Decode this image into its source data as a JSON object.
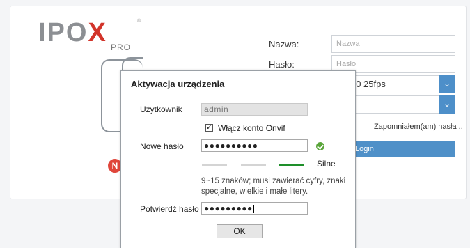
{
  "brand": {
    "logo_main": "IPO",
    "logo_x": "X",
    "logo_sub": "PRO",
    "logo_reg": "®",
    "accent": "#4f90c8",
    "logo_red": "#d2342a"
  },
  "login": {
    "username_label": "Nazwa:",
    "username_placeholder": "Nazwa",
    "password_label": "Hasło:",
    "password_placeholder": "Hasło",
    "stream_select_value": "x1080 25fps",
    "lang_select_value": "i",
    "forgot_link": "Zapomniałem(am) hasła ..",
    "login_button": "Login",
    "badge_letter": "N"
  },
  "modal": {
    "title": "Aktywacja urządzenia",
    "user_label": "Użytkownik",
    "user_value": "admin",
    "onvif_checked": true,
    "onvif_check_mark": "✓",
    "onvif_label": "Włącz konto Onvif",
    "new_password_label": "Nowe hasło",
    "new_password_value": "●●●●●●●●●●",
    "strength_label": "Silne",
    "strength_level": "3 of 3",
    "hint": "9~15 znaków; musi zawierać cyfry, znaki specjalne, wielkie i małe litery.",
    "confirm_label": "Potwierdź hasło",
    "confirm_value": "●●●●●●●●●",
    "ok_button": "OK",
    "valid_icon": "check-circle-icon",
    "strength_color": "#1e8f2a"
  }
}
